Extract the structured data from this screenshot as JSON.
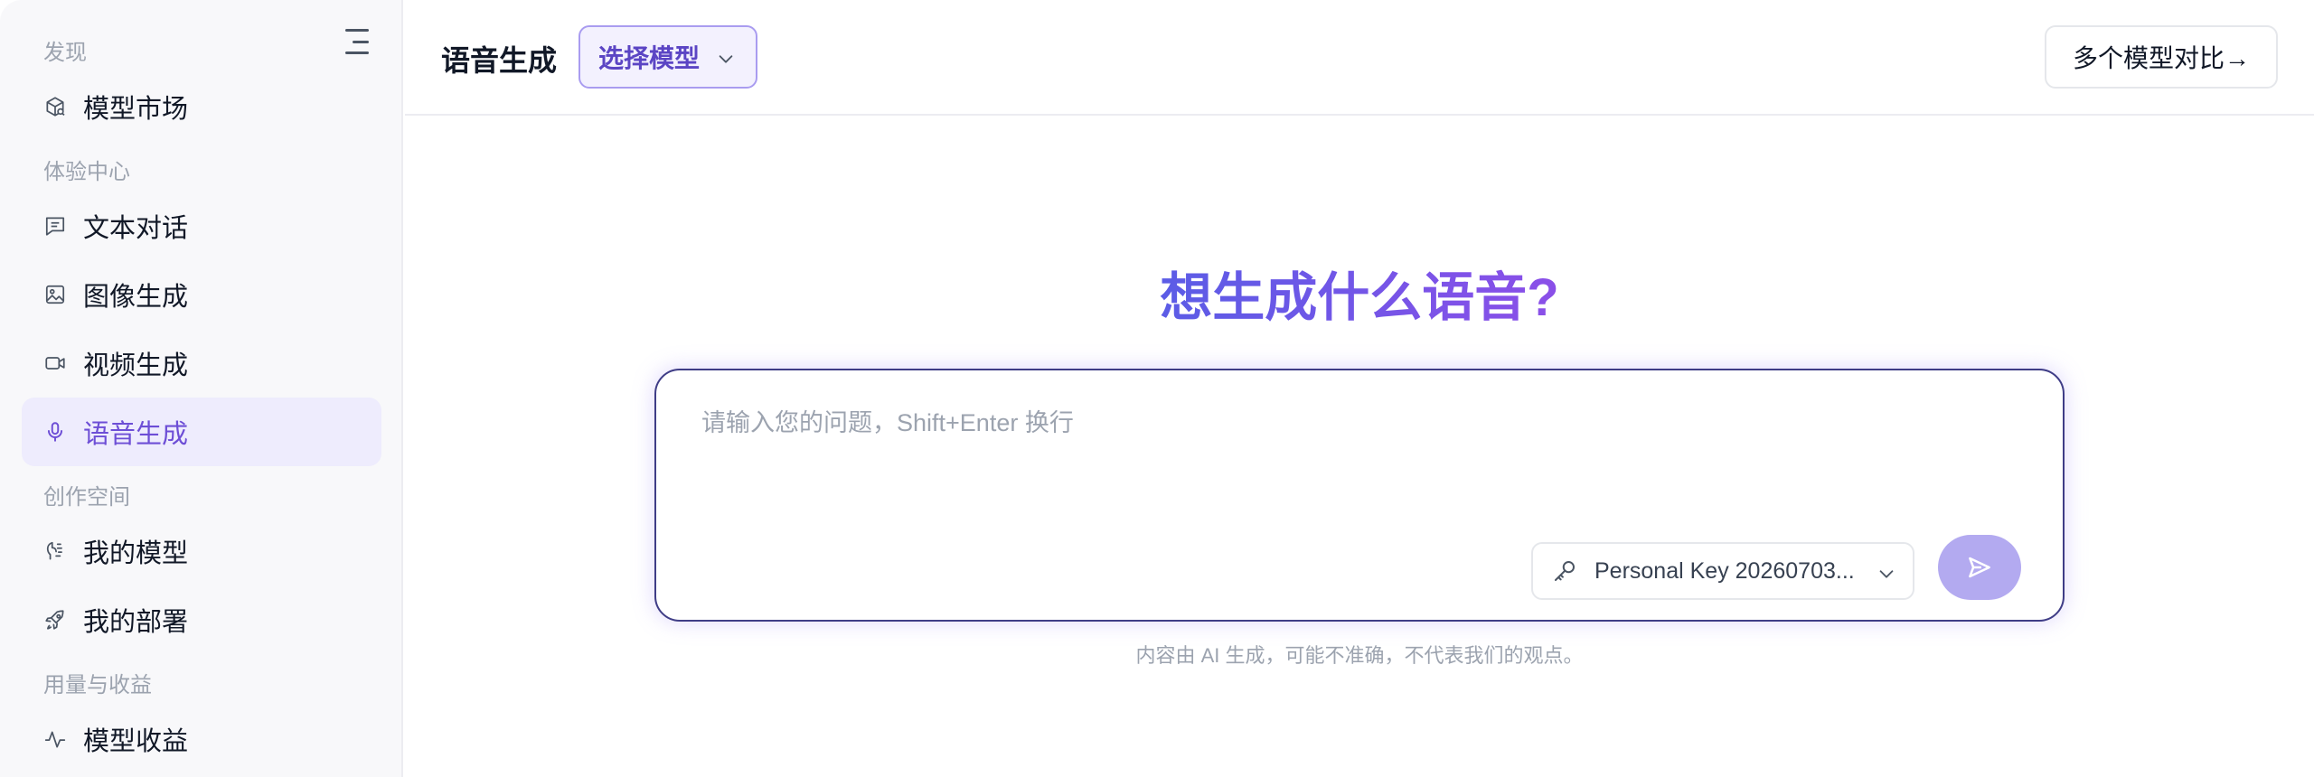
{
  "sidebar": {
    "sections": {
      "discover": "发现",
      "experience": "体验中心",
      "creation": "创作空间",
      "usage": "用量与收益"
    },
    "items": [
      {
        "label": "模型市场",
        "icon": "model-market-icon"
      },
      {
        "label": "文本对话",
        "icon": "chat-icon"
      },
      {
        "label": "图像生成",
        "icon": "image-icon"
      },
      {
        "label": "视频生成",
        "icon": "video-icon"
      },
      {
        "label": "语音生成",
        "icon": "microphone-icon",
        "active": true
      },
      {
        "label": "我的模型",
        "icon": "my-model-icon"
      },
      {
        "label": "我的部署",
        "icon": "rocket-icon"
      },
      {
        "label": "模型收益",
        "icon": "activity-icon"
      }
    ]
  },
  "header": {
    "title": "语音生成",
    "model_select": "选择模型",
    "compare_button": "多个模型对比→"
  },
  "main": {
    "heading": "想生成什么语音?",
    "prompt_placeholder": "请输入您的问题，Shift+Enter 换行",
    "key_select": "Personal Key 20260703...",
    "disclaimer": "内容由 AI 生成，可能不准确，不代表我们的观点。"
  },
  "colors": {
    "accent": "#6d4ed6",
    "active_bg": "#eeecfd",
    "send_button": "#b3aaf0"
  }
}
